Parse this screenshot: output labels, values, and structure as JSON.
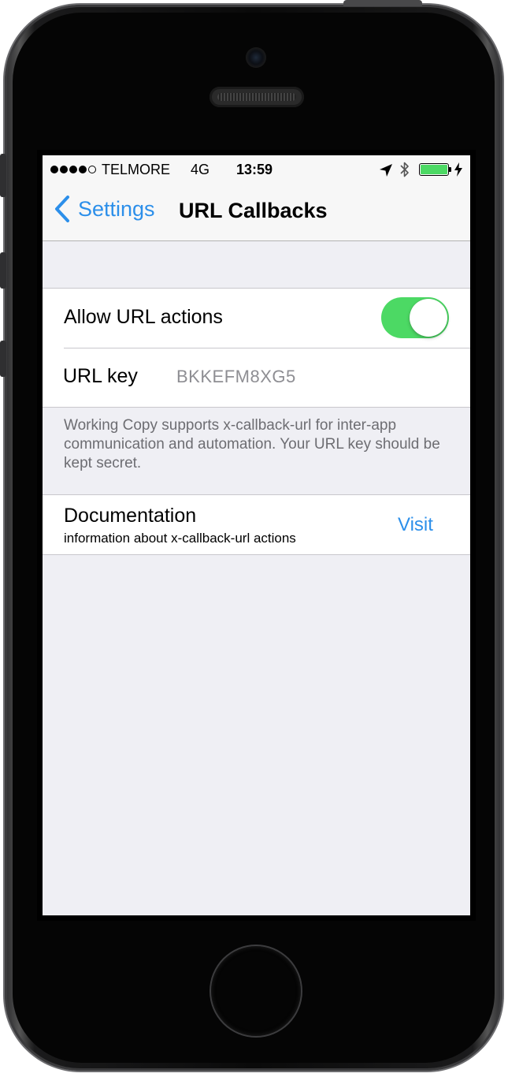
{
  "status_bar": {
    "signal_bars_filled": 4,
    "signal_bars_total": 5,
    "carrier": "TELMORE",
    "network": "4G",
    "time": "13:59",
    "battery_level": 1.0,
    "battery_color": "#4cd964"
  },
  "nav": {
    "back_label": "Settings",
    "title": "URL Callbacks"
  },
  "settings": {
    "allow_actions": {
      "label": "Allow URL actions",
      "enabled": true
    },
    "url_key": {
      "label": "URL key",
      "value": "BKKEFM8XG5"
    },
    "note": "Working Copy supports x-callback-url for inter-app communication and automation. Your URL key should be kept secret."
  },
  "documentation": {
    "title": "Documentation",
    "subtitle": "information about x-callback-url actions",
    "action": "Visit"
  },
  "colors": {
    "accent": "#2c8fea",
    "toggle_on": "#4cd964",
    "background": "#efeff4"
  }
}
